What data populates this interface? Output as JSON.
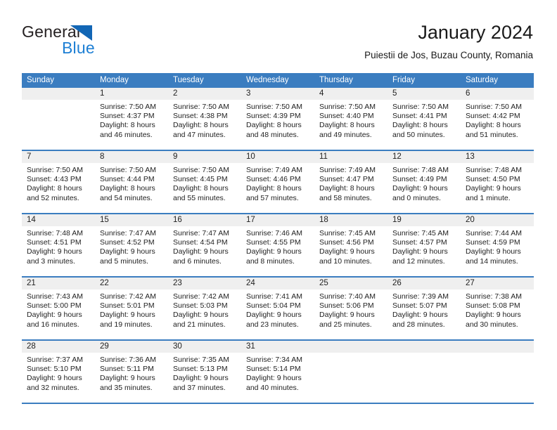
{
  "brand": {
    "name_part1": "General",
    "name_part2": "Blue",
    "color_dark": "#231f20",
    "color_blue": "#1d7fd4"
  },
  "header": {
    "title": "January 2024",
    "subtitle": "Puiestii de Jos, Buzau County, Romania"
  },
  "theme": {
    "header_blue": "#3b7dc0",
    "day_band_gray": "#efefef",
    "text": "#222222"
  },
  "weekdays": [
    "Sunday",
    "Monday",
    "Tuesday",
    "Wednesday",
    "Thursday",
    "Friday",
    "Saturday"
  ],
  "weeks": [
    [
      {
        "day": "",
        "empty": true,
        "sunrise": "",
        "sunset": "",
        "daylight1": "",
        "daylight2": ""
      },
      {
        "day": "1",
        "sunrise": "Sunrise: 7:50 AM",
        "sunset": "Sunset: 4:37 PM",
        "daylight1": "Daylight: 8 hours",
        "daylight2": "and 46 minutes."
      },
      {
        "day": "2",
        "sunrise": "Sunrise: 7:50 AM",
        "sunset": "Sunset: 4:38 PM",
        "daylight1": "Daylight: 8 hours",
        "daylight2": "and 47 minutes."
      },
      {
        "day": "3",
        "sunrise": "Sunrise: 7:50 AM",
        "sunset": "Sunset: 4:39 PM",
        "daylight1": "Daylight: 8 hours",
        "daylight2": "and 48 minutes."
      },
      {
        "day": "4",
        "sunrise": "Sunrise: 7:50 AM",
        "sunset": "Sunset: 4:40 PM",
        "daylight1": "Daylight: 8 hours",
        "daylight2": "and 49 minutes."
      },
      {
        "day": "5",
        "sunrise": "Sunrise: 7:50 AM",
        "sunset": "Sunset: 4:41 PM",
        "daylight1": "Daylight: 8 hours",
        "daylight2": "and 50 minutes."
      },
      {
        "day": "6",
        "sunrise": "Sunrise: 7:50 AM",
        "sunset": "Sunset: 4:42 PM",
        "daylight1": "Daylight: 8 hours",
        "daylight2": "and 51 minutes."
      }
    ],
    [
      {
        "day": "7",
        "sunrise": "Sunrise: 7:50 AM",
        "sunset": "Sunset: 4:43 PM",
        "daylight1": "Daylight: 8 hours",
        "daylight2": "and 52 minutes."
      },
      {
        "day": "8",
        "sunrise": "Sunrise: 7:50 AM",
        "sunset": "Sunset: 4:44 PM",
        "daylight1": "Daylight: 8 hours",
        "daylight2": "and 54 minutes."
      },
      {
        "day": "9",
        "sunrise": "Sunrise: 7:50 AM",
        "sunset": "Sunset: 4:45 PM",
        "daylight1": "Daylight: 8 hours",
        "daylight2": "and 55 minutes."
      },
      {
        "day": "10",
        "sunrise": "Sunrise: 7:49 AM",
        "sunset": "Sunset: 4:46 PM",
        "daylight1": "Daylight: 8 hours",
        "daylight2": "and 57 minutes."
      },
      {
        "day": "11",
        "sunrise": "Sunrise: 7:49 AM",
        "sunset": "Sunset: 4:47 PM",
        "daylight1": "Daylight: 8 hours",
        "daylight2": "and 58 minutes."
      },
      {
        "day": "12",
        "sunrise": "Sunrise: 7:48 AM",
        "sunset": "Sunset: 4:49 PM",
        "daylight1": "Daylight: 9 hours",
        "daylight2": "and 0 minutes."
      },
      {
        "day": "13",
        "sunrise": "Sunrise: 7:48 AM",
        "sunset": "Sunset: 4:50 PM",
        "daylight1": "Daylight: 9 hours",
        "daylight2": "and 1 minute."
      }
    ],
    [
      {
        "day": "14",
        "sunrise": "Sunrise: 7:48 AM",
        "sunset": "Sunset: 4:51 PM",
        "daylight1": "Daylight: 9 hours",
        "daylight2": "and 3 minutes."
      },
      {
        "day": "15",
        "sunrise": "Sunrise: 7:47 AM",
        "sunset": "Sunset: 4:52 PM",
        "daylight1": "Daylight: 9 hours",
        "daylight2": "and 5 minutes."
      },
      {
        "day": "16",
        "sunrise": "Sunrise: 7:47 AM",
        "sunset": "Sunset: 4:54 PM",
        "daylight1": "Daylight: 9 hours",
        "daylight2": "and 6 minutes."
      },
      {
        "day": "17",
        "sunrise": "Sunrise: 7:46 AM",
        "sunset": "Sunset: 4:55 PM",
        "daylight1": "Daylight: 9 hours",
        "daylight2": "and 8 minutes."
      },
      {
        "day": "18",
        "sunrise": "Sunrise: 7:45 AM",
        "sunset": "Sunset: 4:56 PM",
        "daylight1": "Daylight: 9 hours",
        "daylight2": "and 10 minutes."
      },
      {
        "day": "19",
        "sunrise": "Sunrise: 7:45 AM",
        "sunset": "Sunset: 4:57 PM",
        "daylight1": "Daylight: 9 hours",
        "daylight2": "and 12 minutes."
      },
      {
        "day": "20",
        "sunrise": "Sunrise: 7:44 AM",
        "sunset": "Sunset: 4:59 PM",
        "daylight1": "Daylight: 9 hours",
        "daylight2": "and 14 minutes."
      }
    ],
    [
      {
        "day": "21",
        "sunrise": "Sunrise: 7:43 AM",
        "sunset": "Sunset: 5:00 PM",
        "daylight1": "Daylight: 9 hours",
        "daylight2": "and 16 minutes."
      },
      {
        "day": "22",
        "sunrise": "Sunrise: 7:42 AM",
        "sunset": "Sunset: 5:01 PM",
        "daylight1": "Daylight: 9 hours",
        "daylight2": "and 19 minutes."
      },
      {
        "day": "23",
        "sunrise": "Sunrise: 7:42 AM",
        "sunset": "Sunset: 5:03 PM",
        "daylight1": "Daylight: 9 hours",
        "daylight2": "and 21 minutes."
      },
      {
        "day": "24",
        "sunrise": "Sunrise: 7:41 AM",
        "sunset": "Sunset: 5:04 PM",
        "daylight1": "Daylight: 9 hours",
        "daylight2": "and 23 minutes."
      },
      {
        "day": "25",
        "sunrise": "Sunrise: 7:40 AM",
        "sunset": "Sunset: 5:06 PM",
        "daylight1": "Daylight: 9 hours",
        "daylight2": "and 25 minutes."
      },
      {
        "day": "26",
        "sunrise": "Sunrise: 7:39 AM",
        "sunset": "Sunset: 5:07 PM",
        "daylight1": "Daylight: 9 hours",
        "daylight2": "and 28 minutes."
      },
      {
        "day": "27",
        "sunrise": "Sunrise: 7:38 AM",
        "sunset": "Sunset: 5:08 PM",
        "daylight1": "Daylight: 9 hours",
        "daylight2": "and 30 minutes."
      }
    ],
    [
      {
        "day": "28",
        "sunrise": "Sunrise: 7:37 AM",
        "sunset": "Sunset: 5:10 PM",
        "daylight1": "Daylight: 9 hours",
        "daylight2": "and 32 minutes."
      },
      {
        "day": "29",
        "sunrise": "Sunrise: 7:36 AM",
        "sunset": "Sunset: 5:11 PM",
        "daylight1": "Daylight: 9 hours",
        "daylight2": "and 35 minutes."
      },
      {
        "day": "30",
        "sunrise": "Sunrise: 7:35 AM",
        "sunset": "Sunset: 5:13 PM",
        "daylight1": "Daylight: 9 hours",
        "daylight2": "and 37 minutes."
      },
      {
        "day": "31",
        "sunrise": "Sunrise: 7:34 AM",
        "sunset": "Sunset: 5:14 PM",
        "daylight1": "Daylight: 9 hours",
        "daylight2": "and 40 minutes."
      },
      {
        "day": "",
        "empty": true,
        "sunrise": "",
        "sunset": "",
        "daylight1": "",
        "daylight2": ""
      },
      {
        "day": "",
        "empty": true,
        "sunrise": "",
        "sunset": "",
        "daylight1": "",
        "daylight2": ""
      },
      {
        "day": "",
        "empty": true,
        "sunrise": "",
        "sunset": "",
        "daylight1": "",
        "daylight2": ""
      }
    ]
  ]
}
